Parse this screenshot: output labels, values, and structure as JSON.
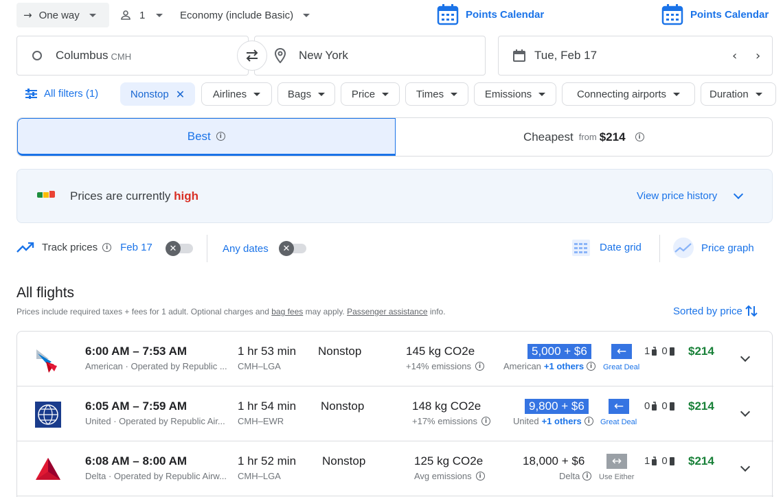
{
  "topbar": {
    "trip_type": "One way",
    "passengers": "1",
    "cabin": "Economy (include Basic)",
    "points_calendar_1": "Points Calendar",
    "points_calendar_2": "Points Calendar"
  },
  "search": {
    "origin_city": "Columbus",
    "origin_code": "CMH",
    "destination": "New York",
    "date": "Tue, Feb 17"
  },
  "filters": {
    "all_filters": "All filters (1)",
    "chips": [
      "Nonstop",
      "Airlines",
      "Bags",
      "Price",
      "Times",
      "Emissions",
      "Connecting airports",
      "Duration"
    ]
  },
  "tabs": {
    "best": "Best",
    "cheapest": "Cheapest",
    "cheapest_from": "from",
    "cheapest_price": "$214"
  },
  "banner": {
    "text": "Prices are currently",
    "level": "high",
    "link": "View price history"
  },
  "track": {
    "label": "Track prices",
    "date": "Feb 17",
    "any_dates": "Any dates",
    "date_grid": "Date grid",
    "price_graph": "Price graph"
  },
  "flights_header": {
    "title": "All flights",
    "note_prefix": "Prices include required taxes + fees for 1 adult. Optional charges and",
    "bag_fees": "bag fees",
    "note_mid": "may apply.",
    "passenger_assistance": "Passenger assistance",
    "note_suffix": "info.",
    "sort": "Sorted by price"
  },
  "flights": [
    {
      "times": "6:00 AM – 7:53 AM",
      "airline": "American · Operated by Republic ...",
      "duration": "1 hr 53 min",
      "route": "CMH–LGA",
      "stops": "Nonstop",
      "co2": "145 kg CO2e",
      "emissions": "+14% emissions",
      "points": "5,000 + $6",
      "points_airline": "American",
      "others": "+1 others",
      "deal": "Great Deal",
      "carry_on": "1",
      "checked": "0",
      "price": "$214"
    },
    {
      "times": "6:05 AM – 7:59 AM",
      "airline": "United · Operated by Republic Air...",
      "duration": "1 hr 54 min",
      "route": "CMH–EWR",
      "stops": "Nonstop",
      "co2": "148 kg CO2e",
      "emissions": "+17% emissions",
      "points": "9,800 + $6",
      "points_airline": "United",
      "others": "+1 others",
      "deal": "Great Deal",
      "carry_on": "0",
      "checked": "0",
      "price": "$214"
    },
    {
      "times": "6:08 AM – 8:00 AM",
      "airline": "Delta · Operated by Republic Airw...",
      "duration": "1 hr 52 min",
      "route": "CMH–LGA",
      "stops": "Nonstop",
      "co2": "125 kg CO2e",
      "emissions": "Avg emissions",
      "points": "18,000 + $6",
      "points_airline": "Delta",
      "others": "",
      "deal": "Use Either",
      "carry_on": "1",
      "checked": "0",
      "price": "$214"
    }
  ],
  "colors": {
    "accent": "#1a73e8",
    "price_green": "#188038",
    "high_red": "#d93025",
    "points_blue": "#3574e2"
  }
}
